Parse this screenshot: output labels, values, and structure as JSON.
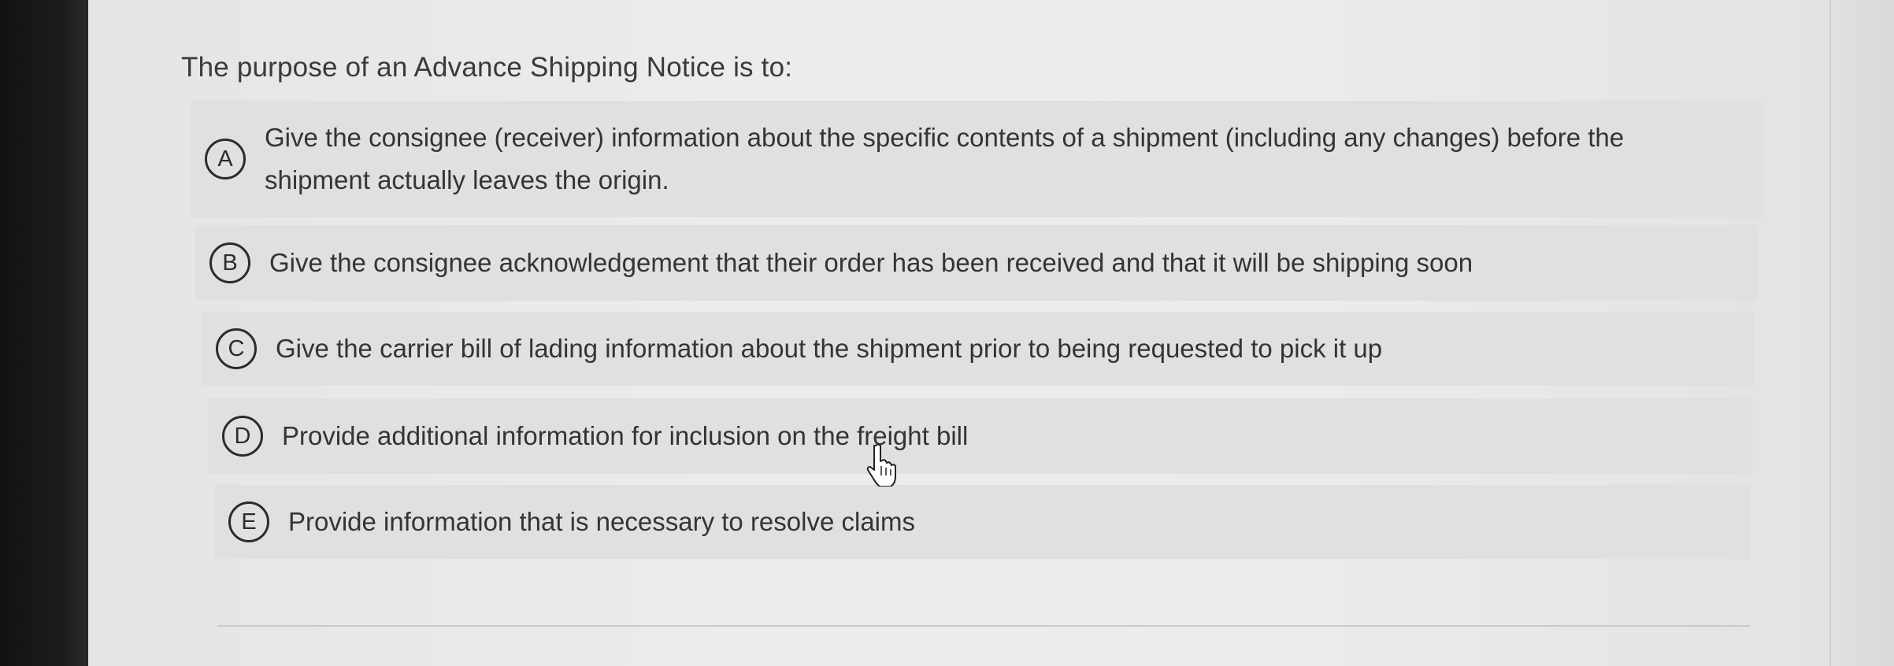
{
  "question": "The purpose of an Advance Shipping Notice is to:",
  "options": [
    {
      "letter": "A",
      "text": "Give the consignee (receiver) information about the specific contents of a shipment (including any changes) before the shipment actually leaves the origin."
    },
    {
      "letter": "B",
      "text": "Give the consignee acknowledgement that their order has been received and that it will be shipping soon"
    },
    {
      "letter": "C",
      "text": "Give the carrier bill of lading information about the shipment prior to being requested to pick it up"
    },
    {
      "letter": "D",
      "text": "Provide additional information for inclusion on the freight bill"
    },
    {
      "letter": "E",
      "text": "Provide information that is necessary to resolve claims"
    }
  ],
  "cursor_icon": "hand-pointer-icon",
  "colors": {
    "option_background": "#e0e0de",
    "text": "#343434",
    "bezel": "#1c1c1c"
  }
}
